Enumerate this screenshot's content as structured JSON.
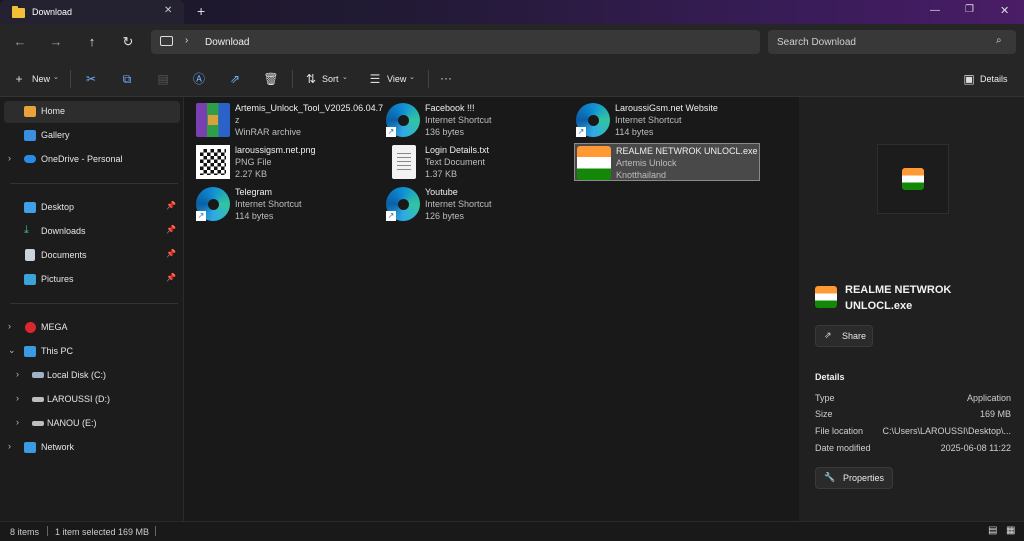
{
  "window": {
    "tab_title": "Download",
    "new_tab": "+",
    "minimize": "—",
    "maximize": "❐",
    "close": "✕"
  },
  "nav": {
    "back": "←",
    "forward": "→",
    "up": "↑",
    "refresh": "↻",
    "breadcrumb": "Download",
    "search_placeholder": "Search Download"
  },
  "toolbar": {
    "new_label": "New",
    "sort_label": "Sort",
    "view_label": "View",
    "more_label": "···",
    "details_label": "Details"
  },
  "sidebar": {
    "home": "Home",
    "gallery": "Gallery",
    "onedrive": "OneDrive - Personal",
    "desktop": "Desktop",
    "downloads": "Downloads",
    "documents": "Documents",
    "pictures": "Pictures",
    "mega": "MEGA",
    "this_pc": "This PC",
    "local_disk": "Local Disk (C:)",
    "laroussi": "LAROUSSI (D:)",
    "nanou": "NANOU (E:)",
    "network": "Network"
  },
  "files": [
    {
      "name": "Artemis_Unlock_Tool_V2025.06.04.7",
      "name2": "z",
      "type": "WinRAR archive",
      "size": ""
    },
    {
      "name": "Facebook !!!",
      "type": "Internet Shortcut",
      "size": "136 bytes"
    },
    {
      "name": "LaroussiGsm.net Website",
      "type": "Internet Shortcut",
      "size": "114 bytes"
    },
    {
      "name": "laroussigsm.net.png",
      "type": "PNG File",
      "size": "2.27 KB"
    },
    {
      "name": "Login Details.txt",
      "type": "Text Document",
      "size": "1.37 KB"
    },
    {
      "name": "REALME NETWROK UNLOCL.exe",
      "type": "Artemis Unlock",
      "size": "Knotthailand"
    },
    {
      "name": "Telegram",
      "type": "Internet Shortcut",
      "size": "114 bytes"
    },
    {
      "name": "Youtube",
      "type": "Internet Shortcut",
      "size": "126 bytes"
    }
  ],
  "details": {
    "title_line1": "REALME NETWROK",
    "title_line2": "UNLOCL.exe",
    "share": "Share",
    "section": "Details",
    "type_label": "Type",
    "type_value": "Application",
    "size_label": "Size",
    "size_value": "169 MB",
    "loc_label": "File location",
    "loc_value": "C:\\Users\\LAROUSSI\\Desktop\\...",
    "date_label": "Date modified",
    "date_value": "2025-06-08 11:22",
    "properties": "Properties"
  },
  "status": {
    "items": "8 items",
    "selected": "1 item selected  169 MB"
  },
  "colors": {
    "accent": "#6fb2ff",
    "folder": "#f2c037",
    "selection": "#494949"
  }
}
